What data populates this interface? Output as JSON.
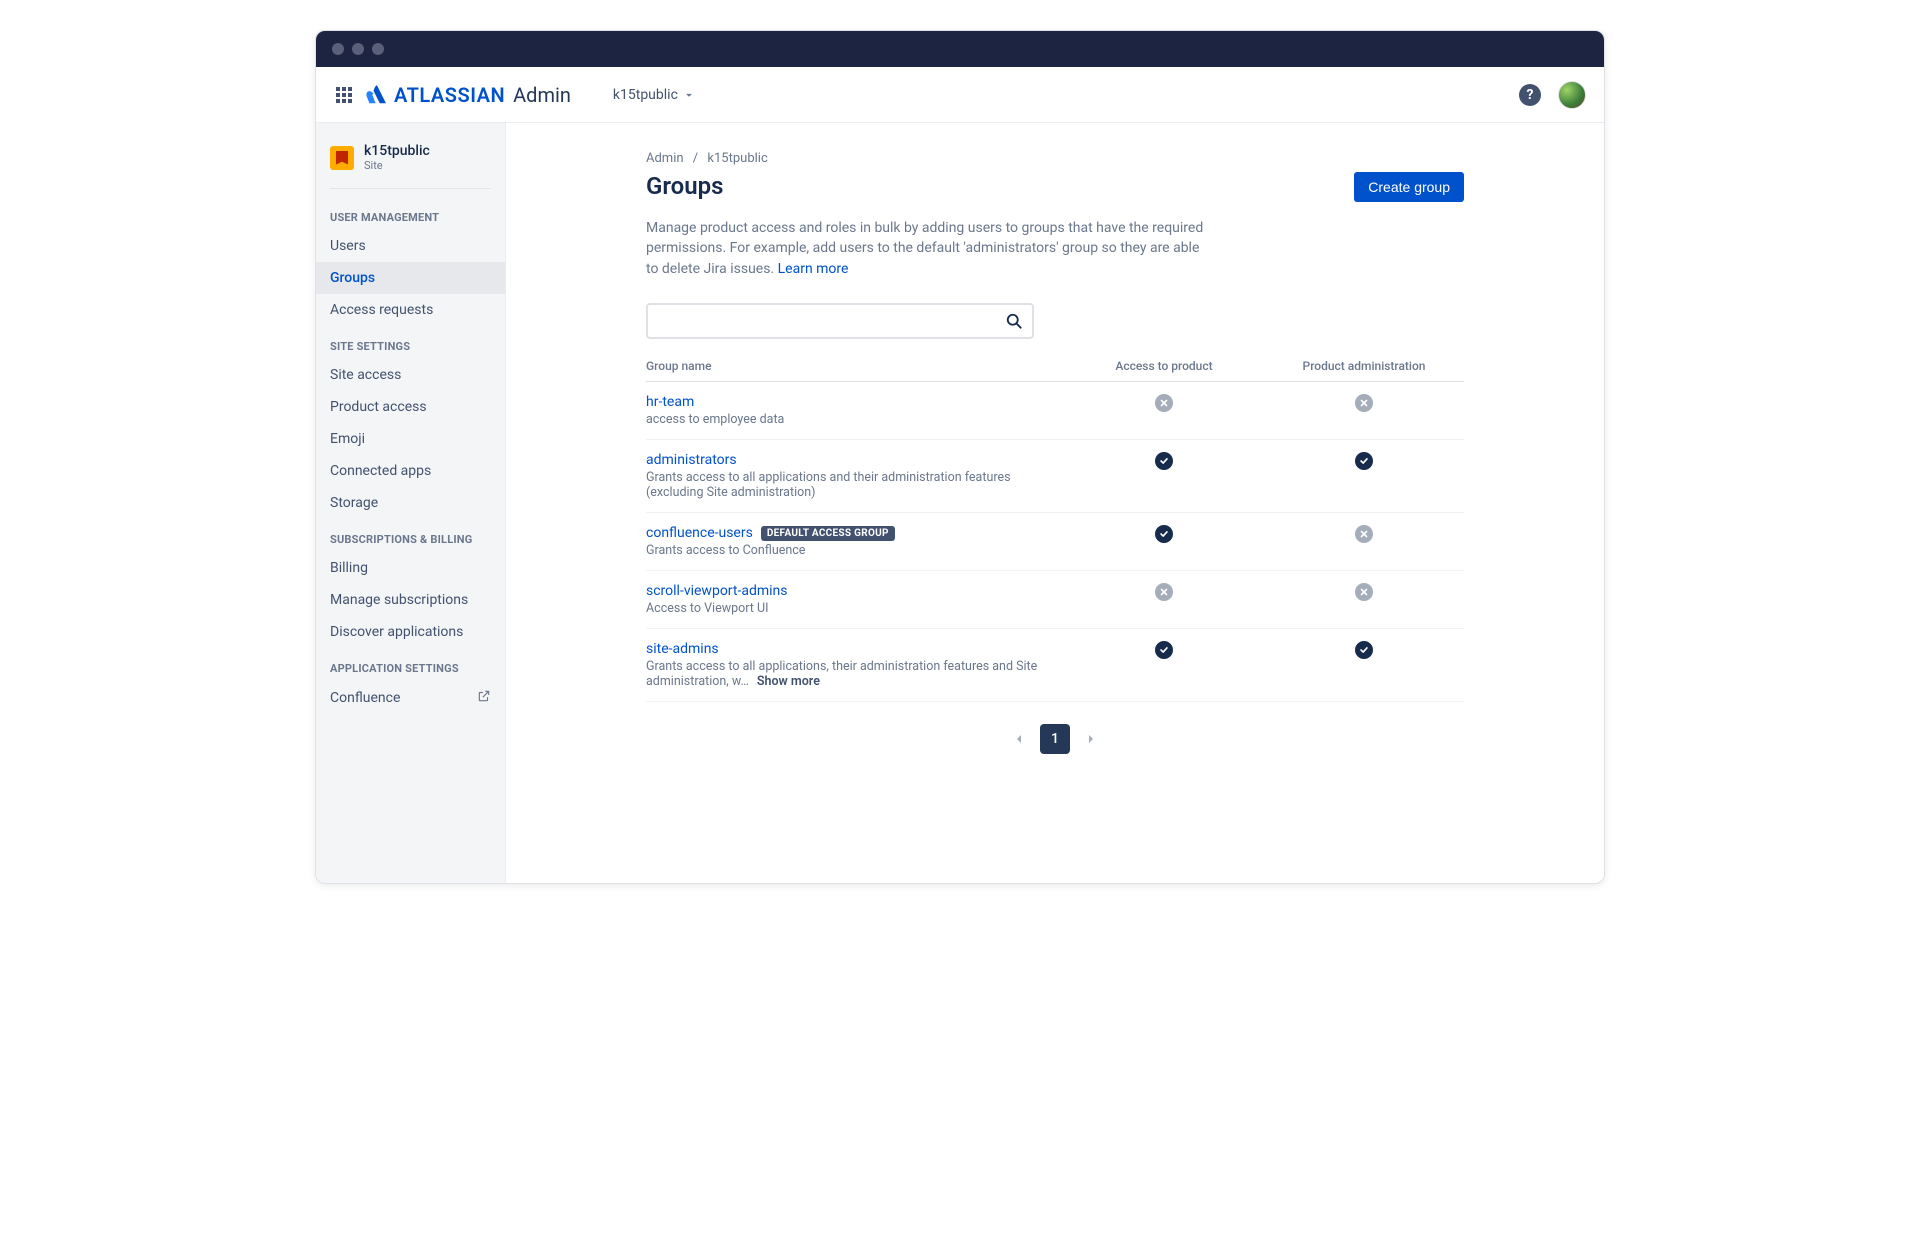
{
  "brand": {
    "name": "ATLASSIAN",
    "suffix": "Admin"
  },
  "sitePicker": {
    "label": "k15tpublic"
  },
  "sidebar": {
    "site": {
      "name": "k15tpublic",
      "sub": "Site"
    },
    "sections": [
      {
        "heading": "USER MANAGEMENT",
        "items": [
          {
            "label": "Users",
            "active": false
          },
          {
            "label": "Groups",
            "active": true
          },
          {
            "label": "Access requests",
            "active": false
          }
        ]
      },
      {
        "heading": "SITE SETTINGS",
        "items": [
          {
            "label": "Site access"
          },
          {
            "label": "Product access"
          },
          {
            "label": "Emoji"
          },
          {
            "label": "Connected apps"
          },
          {
            "label": "Storage"
          }
        ]
      },
      {
        "heading": "SUBSCRIPTIONS & BILLING",
        "items": [
          {
            "label": "Billing"
          },
          {
            "label": "Manage subscriptions"
          },
          {
            "label": "Discover applications"
          }
        ]
      },
      {
        "heading": "APPLICATION SETTINGS",
        "items": [
          {
            "label": "Confluence",
            "external": true
          }
        ]
      }
    ]
  },
  "breadcrumb": {
    "root": "Admin",
    "site": "k15tpublic"
  },
  "page": {
    "title": "Groups",
    "createButton": "Create group",
    "description": "Manage product access and roles in bulk by adding users to groups that have the required permissions. For example, add users to the default 'administrators' group so they are able to delete Jira issues.",
    "learnMore": "Learn more"
  },
  "table": {
    "columns": {
      "name": "Group name",
      "access": "Access to product",
      "admin": "Product administration"
    },
    "defaultBadge": "DEFAULT ACCESS GROUP",
    "showMore": "Show more",
    "rows": [
      {
        "name": "hr-team",
        "desc": "access to employee data",
        "access": false,
        "admin": false
      },
      {
        "name": "administrators",
        "desc": "Grants access to all applications and their administration features (excluding Site administration)",
        "access": true,
        "admin": true
      },
      {
        "name": "confluence-users",
        "desc": "Grants access to Confluence",
        "access": true,
        "admin": false,
        "defaultBadge": true
      },
      {
        "name": "scroll-viewport-admins",
        "desc": "Access to Viewport UI",
        "access": false,
        "admin": false
      },
      {
        "name": "site-admins",
        "desc": "Grants access to all applications, their administration features and Site administration, w…",
        "access": true,
        "admin": true,
        "truncated": true
      }
    ]
  },
  "pagination": {
    "current": "1"
  }
}
